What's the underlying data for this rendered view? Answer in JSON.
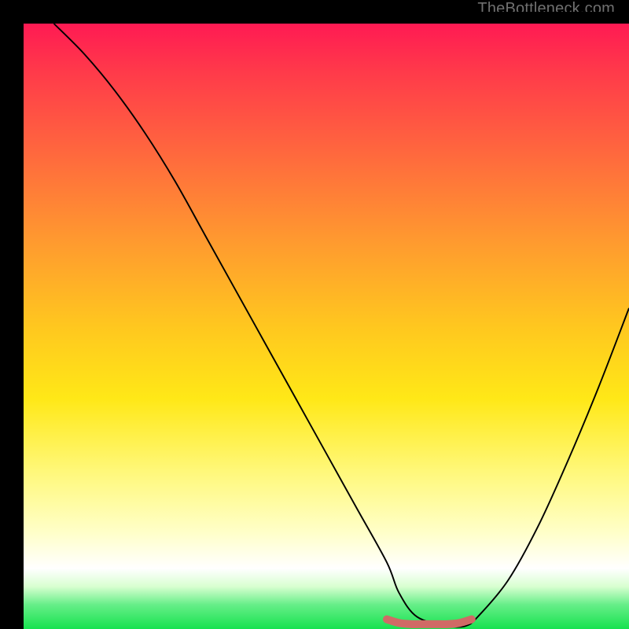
{
  "watermark": "TheBottleneck.com",
  "chart_data": {
    "type": "line",
    "title": "",
    "xlabel": "",
    "ylabel": "",
    "xlim": [
      0,
      100
    ],
    "ylim": [
      0,
      100
    ],
    "grid": false,
    "legend": false,
    "series": [
      {
        "name": "bottleneck-curve",
        "x": [
          5,
          10,
          15,
          20,
          25,
          30,
          35,
          40,
          45,
          50,
          55,
          60,
          62,
          65,
          70,
          73,
          75,
          80,
          85,
          90,
          95,
          100
        ],
        "y": [
          100,
          95,
          89,
          82,
          74,
          65,
          56,
          47,
          38,
          29,
          20,
          11,
          6,
          2,
          0.5,
          0.5,
          2,
          8,
          17,
          28,
          40,
          53
        ],
        "color": "#000000"
      },
      {
        "name": "optimal-zone-marker",
        "x": [
          60,
          62,
          64,
          66,
          68,
          70,
          72,
          74
        ],
        "y": [
          1.6,
          1.0,
          0.8,
          0.8,
          0.8,
          0.8,
          1.0,
          1.6
        ],
        "color": "#d06a66",
        "stroke_width": 10
      }
    ],
    "background_gradient_stops": [
      {
        "pos": 0.0,
        "color": "#ff1a53"
      },
      {
        "pos": 0.5,
        "color": "#ffc71f"
      },
      {
        "pos": 0.9,
        "color": "#ffffff"
      },
      {
        "pos": 1.0,
        "color": "#17e24f"
      }
    ]
  }
}
